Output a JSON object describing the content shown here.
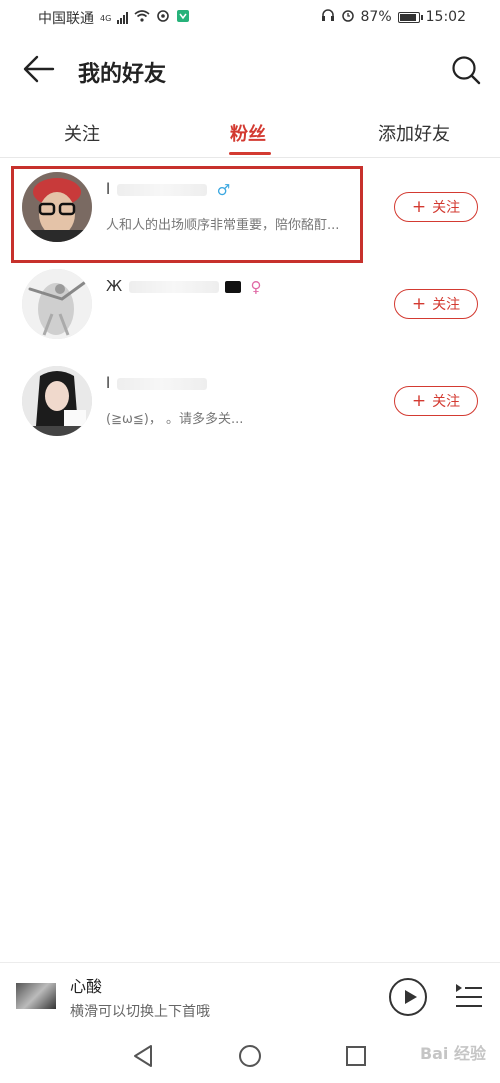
{
  "status_bar": {
    "carrier": "中国联通",
    "network": "4G",
    "battery": "87%",
    "time": "15:02"
  },
  "header": {
    "title": "我的好友"
  },
  "tabs": [
    {
      "label": "关注"
    },
    {
      "label": "粉丝"
    },
    {
      "label": "添加好友"
    }
  ],
  "active_tab": "粉丝",
  "fans": [
    {
      "name": "l",
      "gender": "♂",
      "bio": "人和人的出场顺序非常重要，陪你酩酊...",
      "follow_label": "关注"
    },
    {
      "name": "Ж",
      "gender": "♀",
      "bio": "",
      "follow_label": "关注"
    },
    {
      "name": "l",
      "gender": "",
      "bio": "(≧ω≦)，                    。请多多关...",
      "follow_label": "关注"
    }
  ],
  "player": {
    "song": "心酸",
    "hint": "横滑可以切换上下首哦"
  },
  "watermark": "Bai 经验",
  "colors": {
    "accent": "#d33a31",
    "male": "#3aa7e0",
    "female": "#e06aa6"
  }
}
